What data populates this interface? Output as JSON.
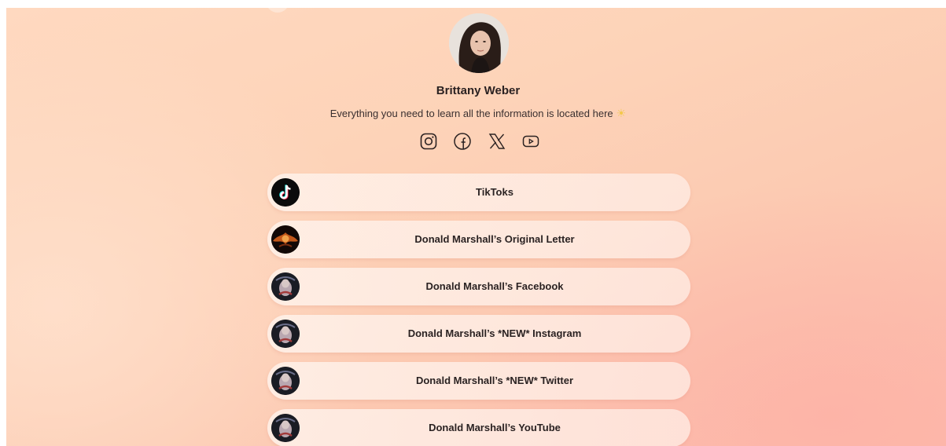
{
  "profile": {
    "name": "Brittany Weber",
    "bio": "Everything you need to learn all the information is located here",
    "bio_emoji": "☀"
  },
  "socials": [
    {
      "name": "instagram-icon"
    },
    {
      "name": "facebook-icon"
    },
    {
      "name": "x-icon"
    },
    {
      "name": "youtube-icon"
    }
  ],
  "links": [
    {
      "label": "TikToks",
      "thumb": "tiktok-logo"
    },
    {
      "label": "Donald Marshall’s Original Letter",
      "thumb": "letter-image"
    },
    {
      "label": "Donald Marshall’s Facebook",
      "thumb": "profile-image"
    },
    {
      "label": "Donald Marshall’s *NEW* Instagram",
      "thumb": "profile-image"
    },
    {
      "label": "Donald Marshall’s *NEW* Twitter",
      "thumb": "profile-image"
    },
    {
      "label": "Donald Marshall’s YouTube",
      "thumb": "profile-image"
    }
  ],
  "colors": {
    "background_peach": "#fdd3b8",
    "background_pink": "#fdbcad",
    "text_dark": "#2b2222",
    "button_fill": "#fff1ea"
  }
}
